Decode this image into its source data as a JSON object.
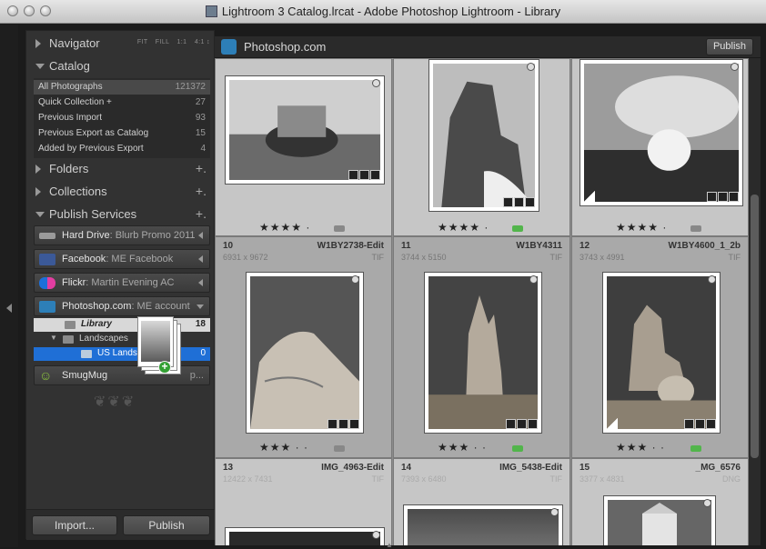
{
  "window": {
    "title": "Lightroom 3 Catalog.lrcat - Adobe Photoshop Lightroom - Library"
  },
  "navigator": {
    "label": "Navigator",
    "options": [
      "FIT",
      "FILL",
      "1:1",
      "4:1 ↕"
    ]
  },
  "catalog": {
    "label": "Catalog",
    "items": [
      {
        "name": "All Photographs",
        "count": "121372"
      },
      {
        "name": "Quick Collection +",
        "count": "27"
      },
      {
        "name": "Previous Import",
        "count": "93"
      },
      {
        "name": "Previous Export as Catalog",
        "count": "15"
      },
      {
        "name": "Added by Previous Export",
        "count": "4"
      }
    ]
  },
  "folders": {
    "label": "Folders",
    "plus": "+."
  },
  "collections": {
    "label": "Collections",
    "plus": "+."
  },
  "publish_services": {
    "label": "Publish Services",
    "plus": "+.",
    "services": [
      {
        "name": "Hard Drive",
        "sub": ": Blurb Promo 2011",
        "color": "#9a9a9a"
      },
      {
        "name": "Facebook",
        "sub": ": ME Facebook",
        "color": "#3b5998"
      },
      {
        "name": "Flickr",
        "sub": ": Martin Evening AC",
        "color": "#e33da1"
      },
      {
        "name": "Photoshop.com",
        "sub": ": ME account",
        "color": "#2d7fb8"
      },
      {
        "name": "SmugMug",
        "sub": "p...",
        "color": "#8dc63f"
      }
    ],
    "photoshop_children": [
      {
        "name": "Library",
        "count": "18"
      },
      {
        "name": "Landscapes",
        "count": ""
      },
      {
        "name": "US Landsc",
        "count": "0"
      }
    ]
  },
  "bottom_buttons": {
    "import": "Import...",
    "publish": "Publish"
  },
  "topbar": {
    "title": "Photoshop.com",
    "publish": "Publish"
  },
  "grid": {
    "rows": [
      {
        "cells": [
          {
            "index": "",
            "filename": "",
            "dims": "",
            "ext": "",
            "stars": "★★★★ ·",
            "label": "#888888"
          },
          {
            "index": "",
            "filename": "",
            "dims": "",
            "ext": "",
            "stars": "★★★★ ·",
            "label": "#52b54b"
          },
          {
            "index": "",
            "filename": "",
            "dims": "",
            "ext": "",
            "stars": "★★★★ ·",
            "label": "#888888"
          }
        ]
      },
      {
        "cells": [
          {
            "index": "10",
            "filename": "W1BY2738-Edit",
            "dims": "6931 x 9672",
            "ext": "TIF",
            "stars": "★★★ · ·",
            "label": "#888888"
          },
          {
            "index": "11",
            "filename": "W1BY4311",
            "dims": "3744 x 5150",
            "ext": "TIF",
            "stars": "★★★ · ·",
            "label": "#52b54b"
          },
          {
            "index": "12",
            "filename": "W1BY4600_1_2b",
            "dims": "3743 x 4991",
            "ext": "TIF",
            "stars": "★★★ · ·",
            "label": "#52b54b"
          }
        ]
      },
      {
        "cells": [
          {
            "index": "13",
            "filename": "IMG_4963-Edit",
            "dims": "12422 x 7431",
            "ext": "TIF",
            "stars": "",
            "label": ""
          },
          {
            "index": "14",
            "filename": "IMG_5438-Edit",
            "dims": "7393 x 6480",
            "ext": "TIF",
            "stars": "",
            "label": ""
          },
          {
            "index": "15",
            "filename": "_MG_6576",
            "dims": "3377 x 4831",
            "ext": "DNG",
            "stars": "",
            "label": ""
          }
        ]
      }
    ]
  }
}
